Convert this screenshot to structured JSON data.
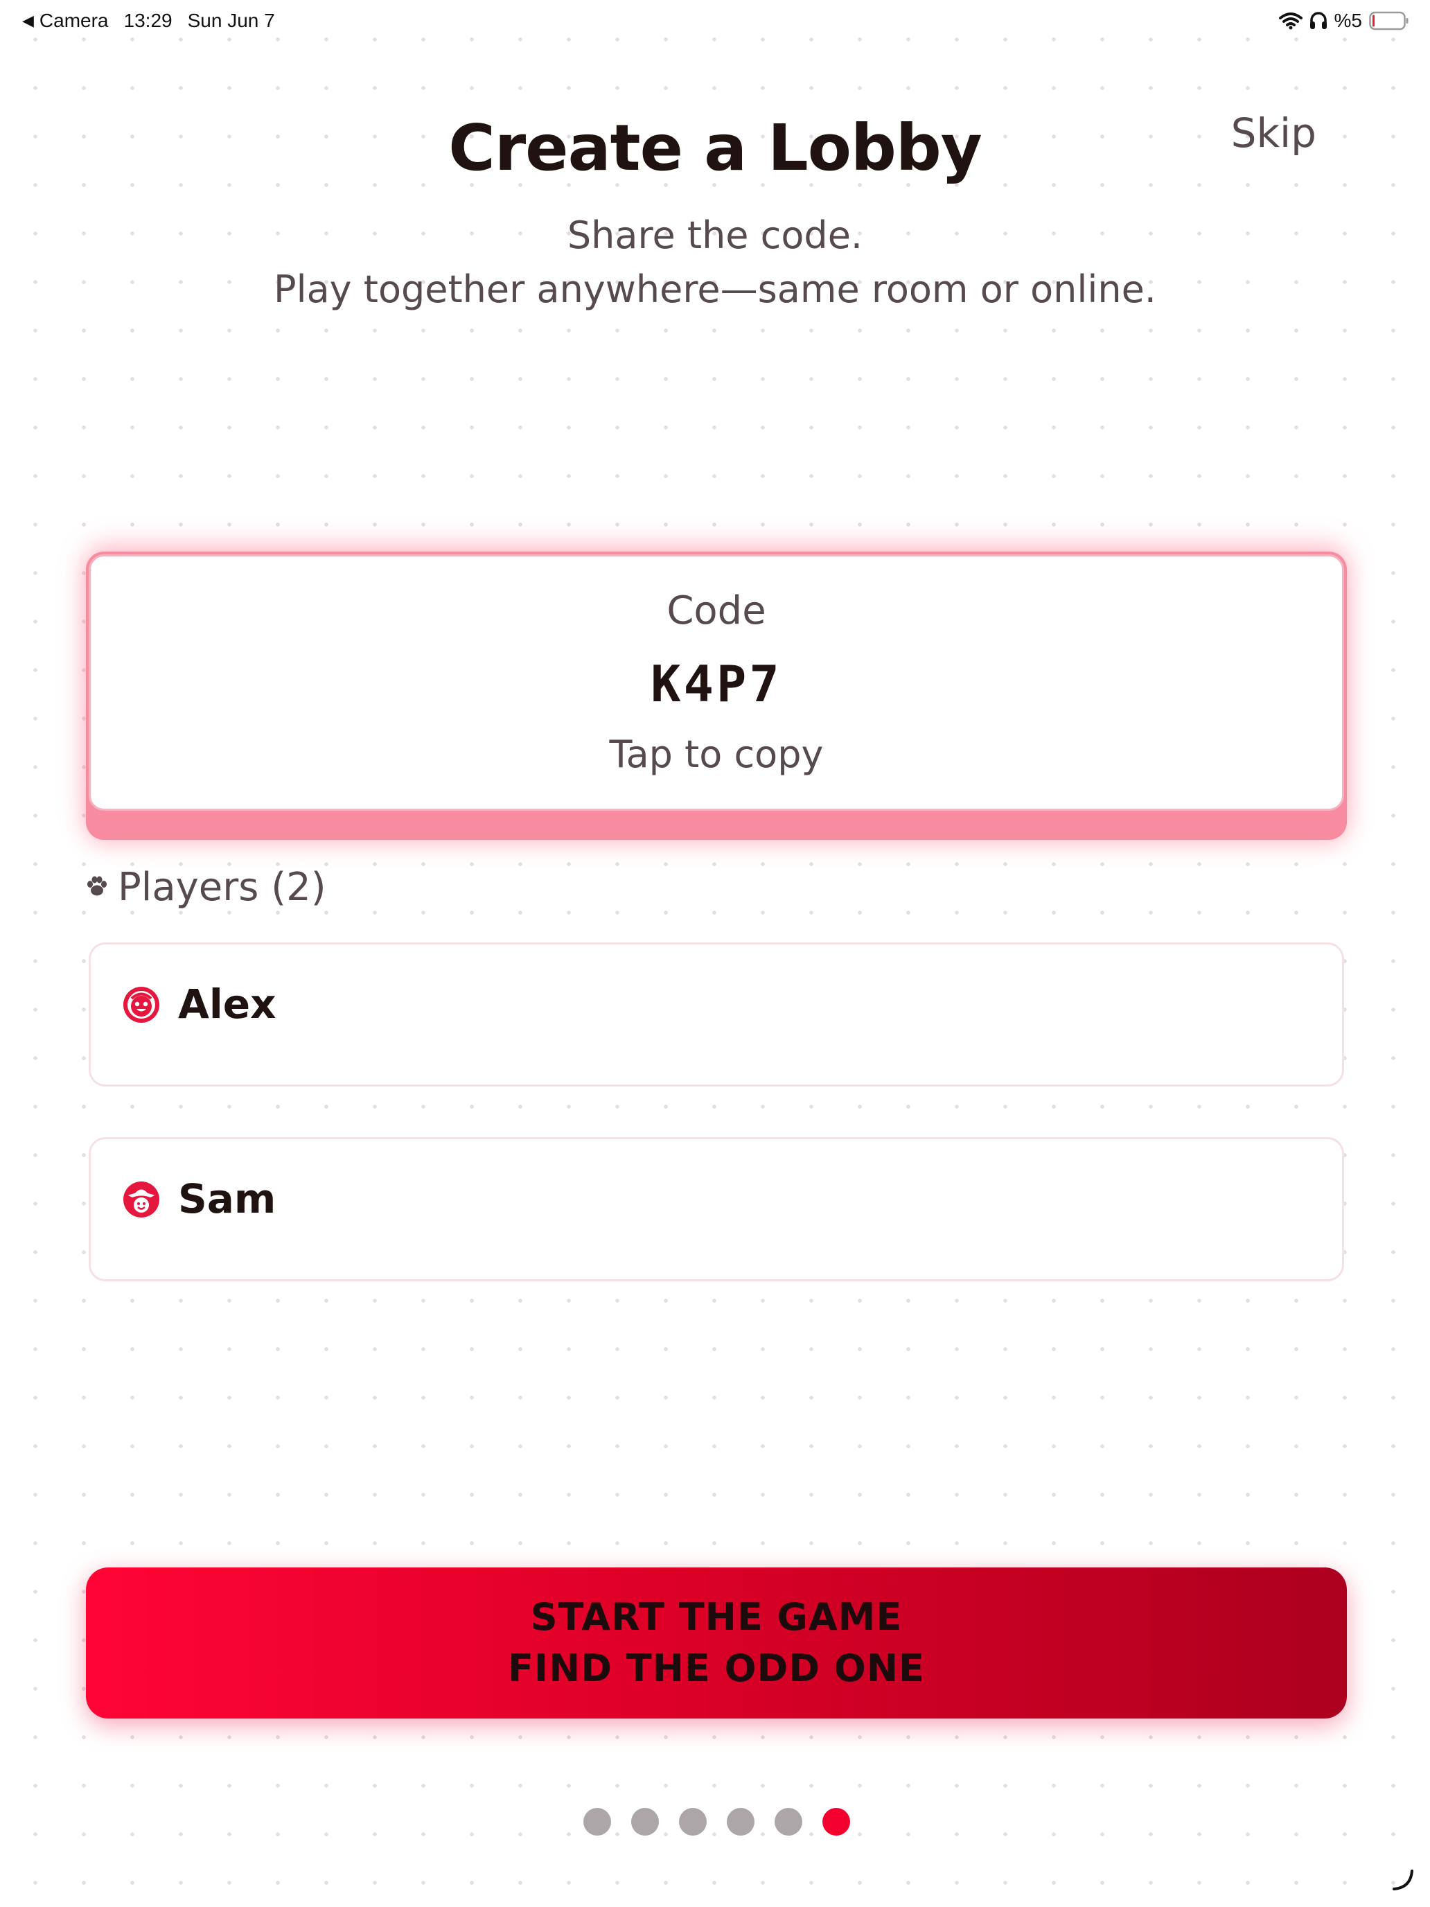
{
  "status_bar": {
    "back_label": "Camera",
    "time": "13:29",
    "date": "Sun Jun 7",
    "battery": "%5"
  },
  "header": {
    "title": "Create a Lobby",
    "skip_label": "Skip",
    "subtitle_line1": "Share the code.",
    "subtitle_line2": "Play together anywhere—same room or online."
  },
  "code_card": {
    "label": "Code",
    "code": "K4P7",
    "hint": "Tap to copy"
  },
  "players": {
    "title": "Players (2)",
    "list": [
      {
        "name": "Alex",
        "avatar": "smiling-face-icon"
      },
      {
        "name": "Sam",
        "avatar": "cowboy-face-icon"
      }
    ]
  },
  "start_button": {
    "line1": "START THE GAME",
    "line2": "FIND THE ODD ONE"
  },
  "pager": {
    "total": 6,
    "active_index": 5
  },
  "colors": {
    "accent": "#f4002f",
    "title_text": "#211212",
    "body_text": "#574a4d",
    "card_glow": "#f78b9f",
    "dot_inactive": "#ada6a8"
  }
}
